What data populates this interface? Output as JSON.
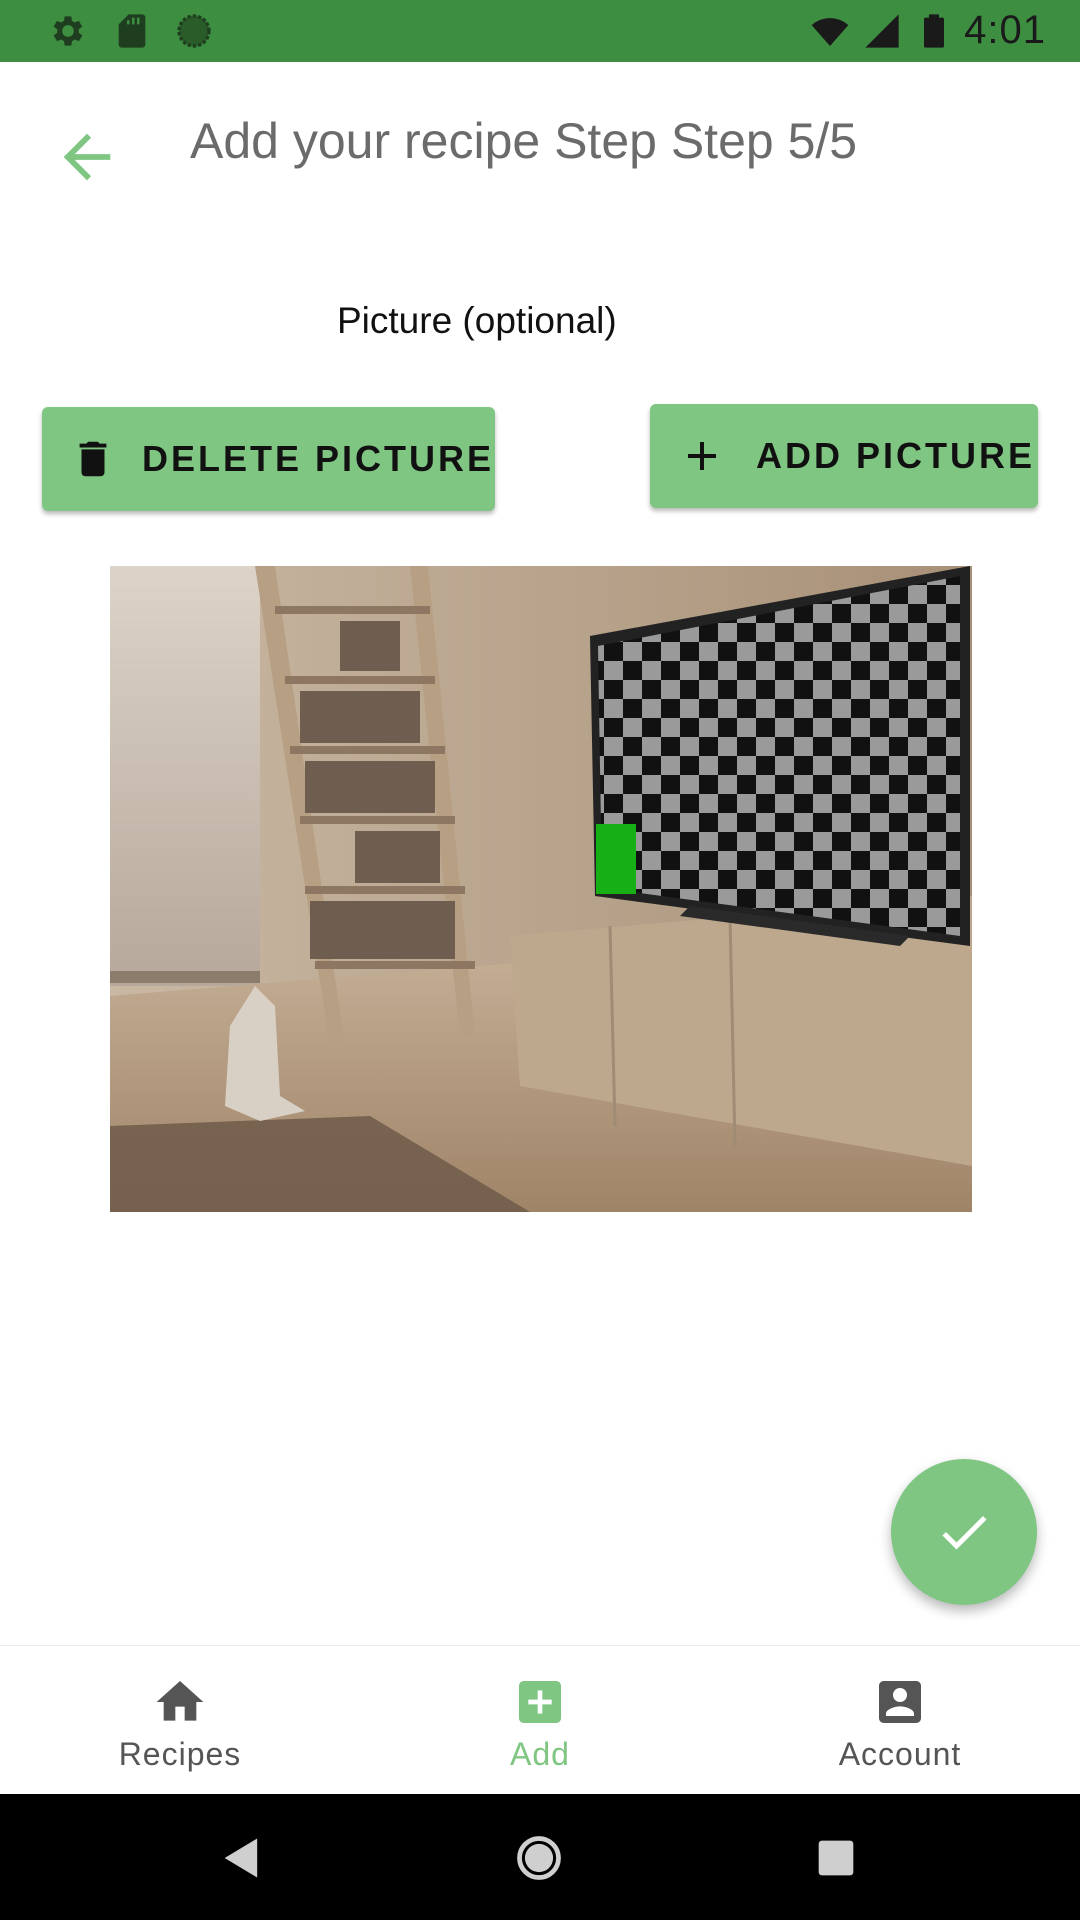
{
  "status_bar": {
    "time": "4:01",
    "left_icons": [
      "gear-icon",
      "sd-card-icon",
      "sync-circle-icon"
    ],
    "right_icons": [
      "wifi-icon",
      "signal-icon",
      "battery-icon"
    ],
    "color": "#3e8e41"
  },
  "toolbar": {
    "title": "Add your recipe Step Step 5/5",
    "back_icon": "arrow-back-icon"
  },
  "content": {
    "section_label": "Picture (optional)",
    "delete_button_label": "DELETE PICTURE",
    "delete_button_icon": "trash-icon",
    "add_button_label": "ADD PICTURE",
    "add_button_icon": "plus-icon",
    "picture_description_icon": "recipe-photo"
  },
  "fab": {
    "icon": "check-icon",
    "color": "#80c683"
  },
  "bottom_nav": {
    "items": [
      {
        "label": "Recipes",
        "icon": "home-icon",
        "active": false
      },
      {
        "label": "Add",
        "icon": "add-box-icon",
        "active": true
      },
      {
        "label": "Account",
        "icon": "account-box-icon",
        "active": false
      }
    ],
    "active_color": "#80c683",
    "inactive_color": "#555555"
  },
  "system_nav": {
    "icons": [
      "back-triangle-icon",
      "home-circle-icon",
      "recents-square-icon"
    ]
  },
  "colors": {
    "accent": "#80c683",
    "status_bar": "#3e8e41"
  }
}
